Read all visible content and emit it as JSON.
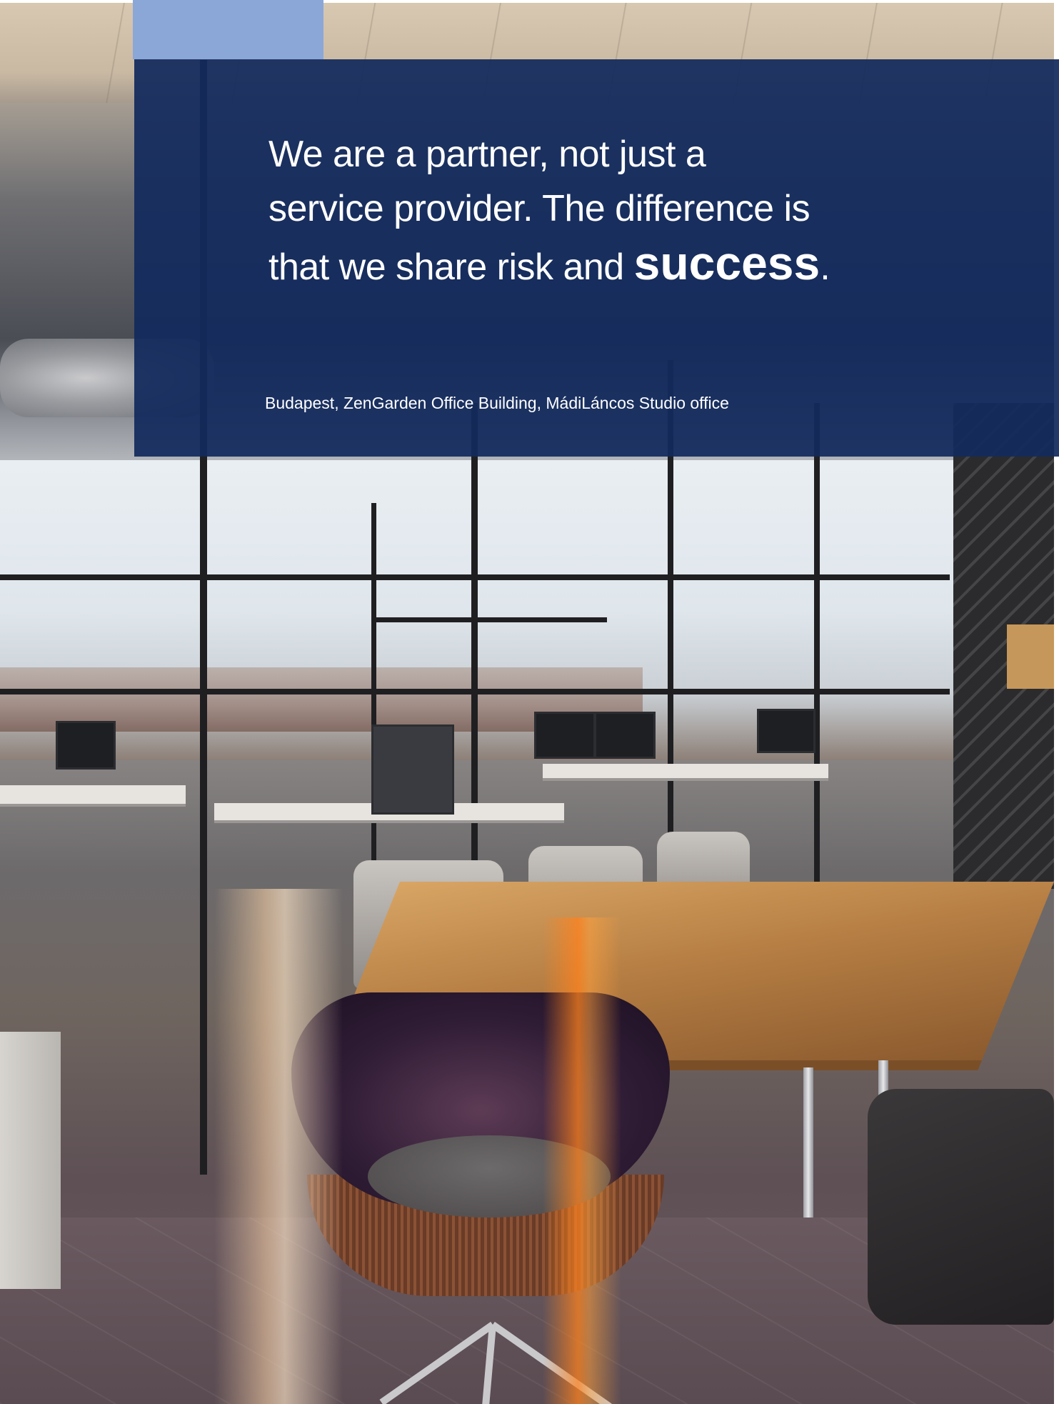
{
  "quote": {
    "line1": "We are a partner, not just a",
    "line2": "service provider. The difference is",
    "line3_prefix": "that we share risk and ",
    "line3_emphasis": "success",
    "line3_suffix": "."
  },
  "caption": "Budapest, ZenGarden Office Building, MádiLáncos Studio office",
  "colors": {
    "panel": "#122a5c",
    "accent_block": "#8aa7d8",
    "text": "#ffffff"
  }
}
